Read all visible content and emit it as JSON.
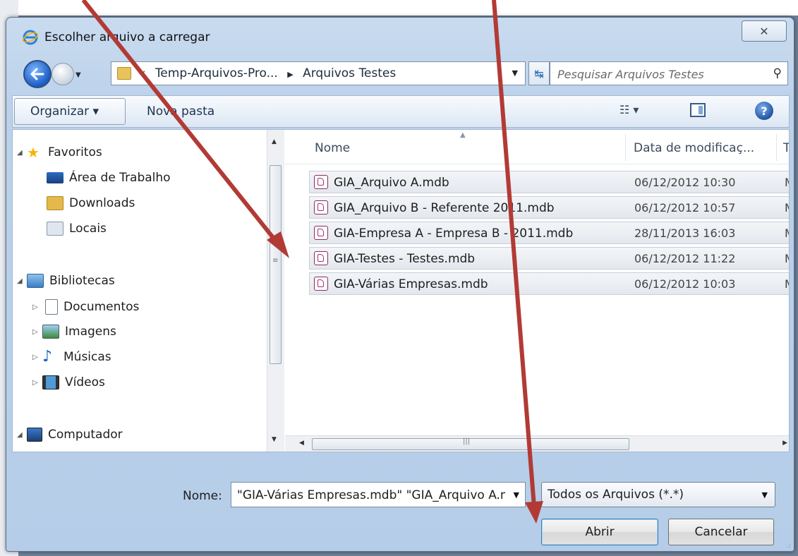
{
  "dialog": {
    "title": "Escolher arquivo a carregar",
    "close_glyph": "✕"
  },
  "navigation": {
    "breadcrumb": [
      "«",
      "Temp-Arquivos-Pro...",
      "Arquivos Testes"
    ],
    "search_placeholder": "Pesquisar Arquivos Testes"
  },
  "toolbar": {
    "organize_label": "Organizar ▾",
    "new_folder_label": "Nova pasta",
    "views_glyph": "☷ ▾",
    "help_glyph": "?"
  },
  "sidebar": {
    "favorites": "Favoritos",
    "desktop": "Área de Trabalho",
    "downloads": "Downloads",
    "recent_places": "Locais",
    "libraries": "Bibliotecas",
    "documents": "Documentos",
    "pictures": "Imagens",
    "music": "Músicas",
    "videos": "Vídeos",
    "computer": "Computador"
  },
  "columns": {
    "name": "Nome",
    "date": "Data de modificaç...",
    "type": "Tip"
  },
  "files": [
    {
      "name": "GIA_Arquivo A.mdb",
      "date": "06/12/2012 10:30",
      "type": "Mi"
    },
    {
      "name": "GIA_Arquivo B -  Referente 2011.mdb",
      "date": "06/12/2012 10:57",
      "type": "Mi"
    },
    {
      "name": "GIA-Empresa A - Empresa B - 2011.mdb",
      "date": "28/11/2013 16:03",
      "type": "Mi"
    },
    {
      "name": "GIA-Testes - Testes.mdb",
      "date": "06/12/2012 11:22",
      "type": "Mi"
    },
    {
      "name": "GIA-Várias Empresas.mdb",
      "date": "06/12/2012 10:03",
      "type": "Mi"
    }
  ],
  "footer": {
    "name_label": "Nome:",
    "name_value": "\"GIA-Várias Empresas.mdb\" \"GIA_Arquivo A.mdb\"",
    "filter_value": "Todos os Arquivos (*.*)",
    "open_label": "Abrir",
    "cancel_label": "Cancelar"
  },
  "colors": {
    "annotation_arrow": "#b23a35",
    "dialog_frame": "#bcd2eb",
    "selection": "#e4e8ee"
  }
}
